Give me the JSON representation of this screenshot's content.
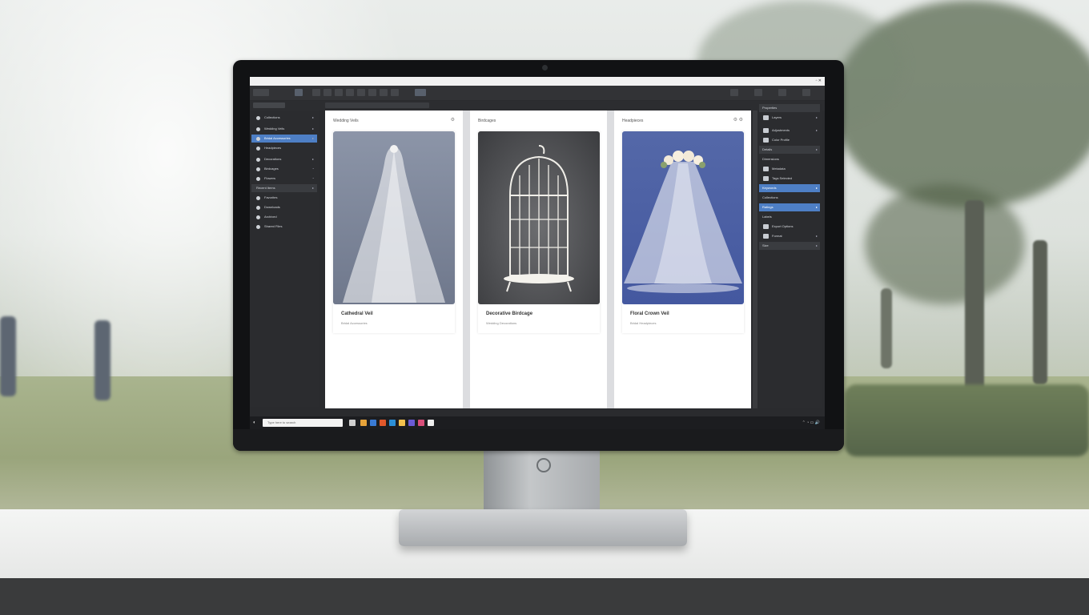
{
  "window": {
    "menu": [
      "File",
      "Edit",
      "Browse",
      "Insert",
      "Tools",
      "View",
      "Window",
      "Help"
    ],
    "window_controls": "▫ ✕"
  },
  "left_panel": {
    "items": [
      {
        "label": "Collections",
        "state": "normal"
      },
      {
        "label": "Wedding Veils",
        "state": "normal"
      },
      {
        "label": "Bridal Accessories",
        "state": "active"
      },
      {
        "label": "Headpieces",
        "state": "normal"
      },
      {
        "label": "Decorations",
        "state": "normal"
      },
      {
        "label": "Birdcages",
        "state": "normal"
      },
      {
        "label": "Flowers",
        "state": "normal"
      },
      {
        "label": "Recent Items",
        "state": "section"
      },
      {
        "label": "Favorites",
        "state": "normal"
      },
      {
        "label": "Downloads",
        "state": "normal"
      },
      {
        "label": "Archived",
        "state": "normal"
      },
      {
        "label": "Shared Files",
        "state": "normal"
      }
    ]
  },
  "columns": [
    {
      "header": "Wedding Veils",
      "card_title": "Cathedral Veil",
      "card_sub": "Bridal Accessories"
    },
    {
      "header": "Birdcages",
      "card_title": "Decorative Birdcage",
      "card_sub": "Wedding Decorations"
    },
    {
      "header": "Headpieces",
      "card_title": "Floral Crown Veil",
      "card_sub": "Bridal Headpieces"
    }
  ],
  "right_panel": {
    "items": [
      {
        "label": "Properties",
        "state": "section"
      },
      {
        "label": "Layers",
        "state": "normal"
      },
      {
        "label": "Adjustments",
        "state": "normal"
      },
      {
        "label": "Color Profile",
        "state": "section"
      },
      {
        "label": "Details",
        "state": "normal"
      },
      {
        "label": "Dimensions",
        "state": "normal"
      },
      {
        "label": "Metadata",
        "state": "normal"
      },
      {
        "label": "Tags Selected",
        "state": "active"
      },
      {
        "label": "Keywords",
        "state": "normal"
      },
      {
        "label": "Collections",
        "state": "active"
      },
      {
        "label": "Ratings",
        "state": "normal"
      },
      {
        "label": "Labels",
        "state": "normal"
      },
      {
        "label": "Export Options",
        "state": "section"
      },
      {
        "label": "Format",
        "state": "normal"
      },
      {
        "label": "Size",
        "state": "normal"
      }
    ]
  },
  "taskbar": {
    "search_placeholder": "Type here to search",
    "apps": [
      "#e7a33a",
      "#3a7bd5",
      "#e0582b",
      "#2c8fd6",
      "#f2c14e",
      "#6b5bd6",
      "#d94f7a",
      "#eeeeee"
    ],
    "tray": "⌃ ◔ ▭ 🔊"
  },
  "colors": {
    "accent": "#4e7fc5",
    "panel": "#2b2c2f",
    "card_bg": "#ffffff"
  }
}
